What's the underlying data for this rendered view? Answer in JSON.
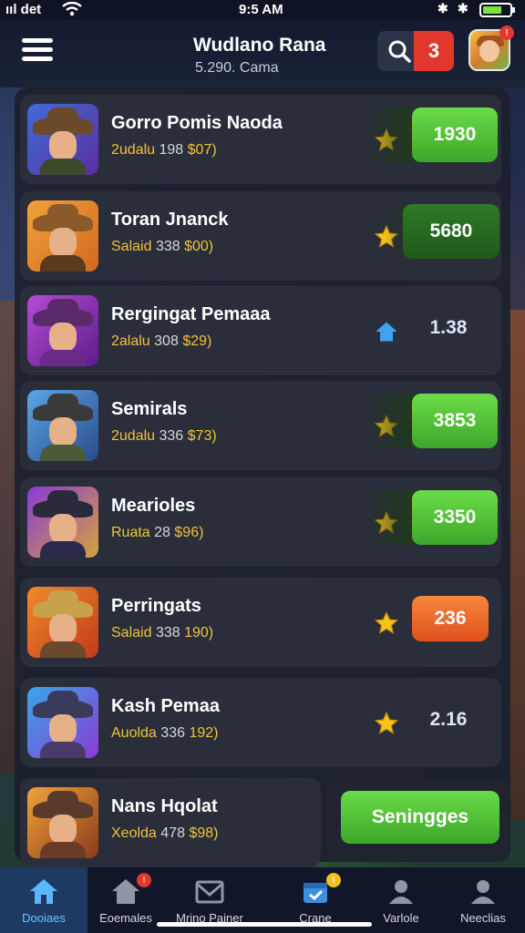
{
  "status": {
    "carrier": "ııl det",
    "time": "9:5 AM"
  },
  "header": {
    "title": "Wudlano Rana",
    "subtitle": "5.290. Cama",
    "search_count": "3",
    "avatar_badge": "!"
  },
  "games": [
    {
      "name": "Gorro Pomis Naoda",
      "meta_a": "2udalu",
      "meta_b": "198",
      "meta_c": "$07)",
      "value": "1930",
      "style": "green",
      "icon": "star"
    },
    {
      "name": "Toran Jnanck",
      "meta_a": "Salaid",
      "meta_b": "338",
      "meta_c": "$00)",
      "value": "5680",
      "style": "darkgreen",
      "icon": "star"
    },
    {
      "name": "Rergingat Pemaaa",
      "meta_a": "2alalu",
      "meta_b": "308",
      "meta_c": "$29)",
      "value": "1.38",
      "style": "plain",
      "icon": "house"
    },
    {
      "name": "Semirals",
      "meta_a": "2udalu",
      "meta_b": "336",
      "meta_c": "$73)",
      "value": "3853",
      "style": "green",
      "icon": "star"
    },
    {
      "name": "Mearioles",
      "meta_a": "Ruata",
      "meta_b": "28",
      "meta_c": "$96)",
      "value": "3350",
      "style": "green",
      "icon": "star"
    },
    {
      "name": "Perringats",
      "meta_a": "Salaid",
      "meta_b": "338",
      "meta_c": "190)",
      "value": "236",
      "style": "orange",
      "icon": "star"
    },
    {
      "name": "Kash Pemaa",
      "meta_a": "Auolda",
      "meta_b": "336",
      "meta_c": "192)",
      "value": "2.16",
      "style": "plain",
      "icon": "star"
    },
    {
      "name": "Nans Hqolat",
      "meta_a": "Xeolda",
      "meta_b": "478",
      "meta_c": "$98)",
      "value": "Seningges",
      "style": "cta",
      "icon": "none"
    }
  ],
  "tabs": [
    {
      "label": "Dooiaes",
      "icon": "home-icon",
      "badge": ""
    },
    {
      "label": "Eoemales",
      "icon": "house-alert-icon",
      "badge": "!"
    },
    {
      "label": "Mrino Painer",
      "icon": "mail-icon",
      "badge": ""
    },
    {
      "label": "Crane",
      "icon": "calendar-icon",
      "badge": "!"
    },
    {
      "label": "Varlole",
      "icon": "person-icon",
      "badge": ""
    },
    {
      "label": "Neeclias",
      "icon": "person-icon",
      "badge": ""
    }
  ],
  "colors": {
    "accent_green": "#5fcf3f",
    "accent_orange": "#f06a2a",
    "badge_red": "#e2372c",
    "meta_yellow": "#f2c23a",
    "active_tab": "#1e3a63"
  }
}
